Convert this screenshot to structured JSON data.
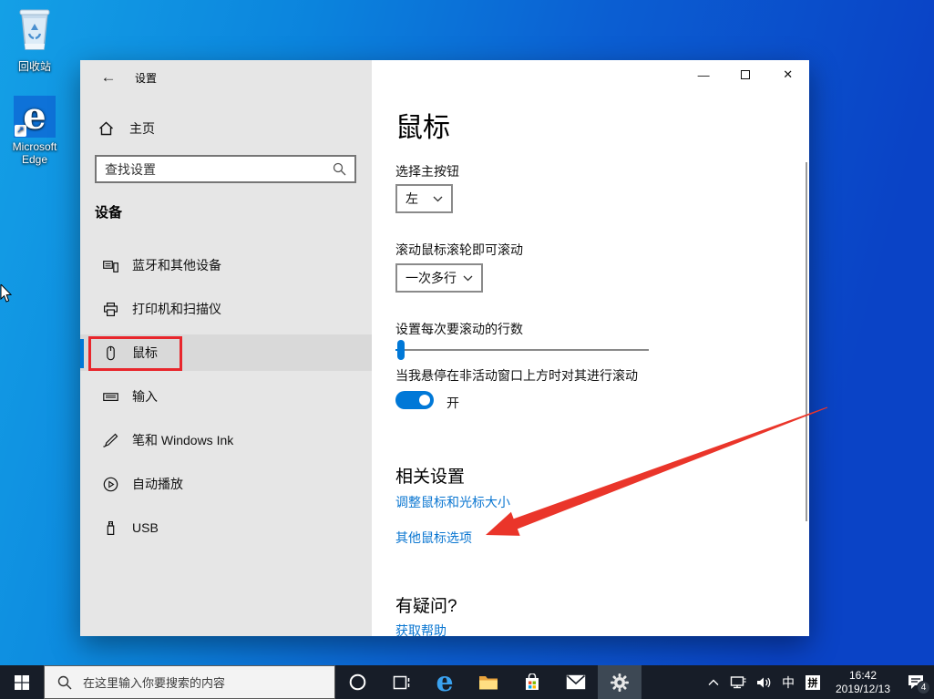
{
  "desktop": {
    "recycle_bin_label": "回收站",
    "edge_label": "Microsoft Edge"
  },
  "window": {
    "title": "设置",
    "controls": {
      "minimize": "—",
      "maximize": "",
      "close": "✕"
    },
    "sidebar": {
      "home_label": "主页",
      "search_placeholder": "查找设置",
      "section_heading": "设备",
      "items": [
        {
          "label": "蓝牙和其他设备"
        },
        {
          "label": "打印机和扫描仪"
        },
        {
          "label": "鼠标",
          "selected": true
        },
        {
          "label": "输入"
        },
        {
          "label": "笔和 Windows Ink"
        },
        {
          "label": "自动播放"
        },
        {
          "label": "USB"
        }
      ]
    },
    "main": {
      "page_title": "鼠标",
      "primary_button_label": "选择主按钮",
      "primary_button_value": "左",
      "wheel_label": "滚动鼠标滚轮即可滚动",
      "wheel_value": "一次多行",
      "lines_label": "设置每次要滚动的行数",
      "slider_position_percent": 1,
      "inactive_scroll_label": "当我悬停在非活动窗口上方时对其进行滚动",
      "inactive_scroll_state": "开",
      "related_heading": "相关设置",
      "related_link_1": "调整鼠标和光标大小",
      "related_link_2": "其他鼠标选项",
      "help_heading": "有疑问?",
      "help_link": "获取帮助"
    }
  },
  "taskbar": {
    "search_placeholder": "在这里输入你要搜索的内容",
    "ime_language": "中",
    "ime_mode": "拼",
    "time": "16:42",
    "date": "2019/12/13",
    "notification_count": "4"
  },
  "colors": {
    "accent_blue": "#0078d7",
    "link_blue": "#0a76d1",
    "annotation_red": "#e8262c",
    "sidebar_gray": "#e6e6e6",
    "taskbar_dark": "#171d28"
  }
}
